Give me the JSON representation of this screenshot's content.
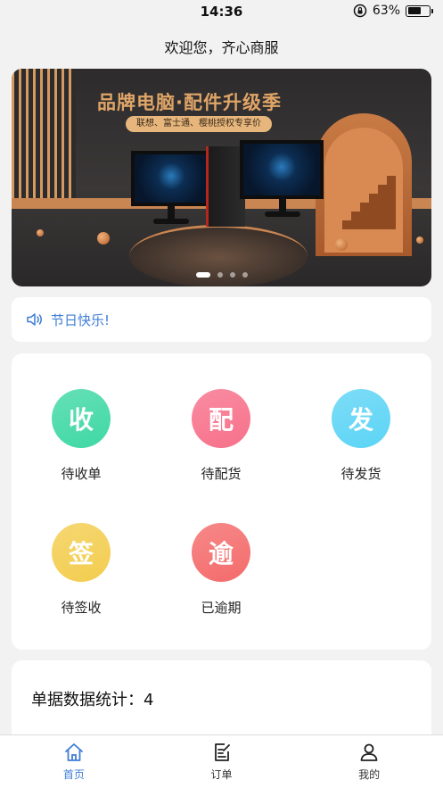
{
  "status_bar": {
    "time": "14:36",
    "battery_text": "63%",
    "battery_level": 0.63
  },
  "header": {
    "title": "欢迎您，齐心商服"
  },
  "banner": {
    "title": "品牌电脑·配件升级季",
    "subtitle": "联想、富士通、樱桃授权专享价",
    "slide_count": 4,
    "active_slide": 0
  },
  "notice": {
    "text": "节日快乐!"
  },
  "orders": [
    {
      "glyph": "收",
      "label": "待收单",
      "color": "#3fd8a5"
    },
    {
      "glyph": "配",
      "label": "待配货",
      "color": "#f7708a"
    },
    {
      "glyph": "发",
      "label": "待发货",
      "color": "#5cd4f5"
    },
    {
      "glyph": "签",
      "label": "待签收",
      "color": "#f3cd4f"
    },
    {
      "glyph": "逾",
      "label": "已逾期",
      "color": "#f46b6b"
    }
  ],
  "stats": {
    "label": "单据数据统计：",
    "count": "4"
  },
  "tabs": [
    {
      "label": "首页",
      "icon": "home-icon",
      "active": true
    },
    {
      "label": "订单",
      "icon": "orders-icon",
      "active": false
    },
    {
      "label": "我的",
      "icon": "user-icon",
      "active": false
    }
  ],
  "colors": {
    "accent": "#3f7dd6"
  }
}
